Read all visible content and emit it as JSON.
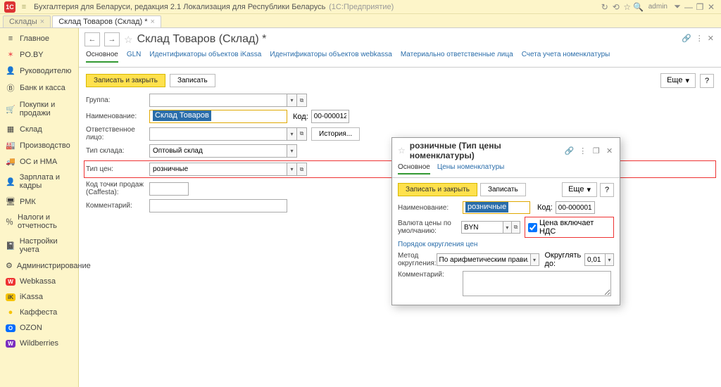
{
  "titlebar": {
    "logo": "1C",
    "menu_glyph": "≡",
    "title": "Бухгалтерия для Беларуси, редакция 2.1 Локализация для Республики Беларусь",
    "paren": "(1С:Предприятие)",
    "user": "admin",
    "icons": {
      "reload": "↻",
      "history": "⟲",
      "star": "☆",
      "search": "🔍",
      "sep": "⏷",
      "minimize": "—",
      "maximize": "❐",
      "close": "✕"
    }
  },
  "tabs": {
    "items": [
      {
        "label": "Склады"
      },
      {
        "label": "Склад Товаров (Склад) *"
      }
    ],
    "close": "×"
  },
  "sidebar": {
    "items": [
      {
        "icon": "≡",
        "label": "Главное"
      },
      {
        "icon": "✶",
        "label": "PO.BY",
        "iconColor": "#e55"
      },
      {
        "icon": "👤",
        "label": "Руководителю"
      },
      {
        "icon": "Ⓑ",
        "label": "Банк и касса"
      },
      {
        "icon": "🛒",
        "label": "Покупки и продажи"
      },
      {
        "icon": "▦",
        "label": "Склад"
      },
      {
        "icon": "🏭",
        "label": "Производство"
      },
      {
        "icon": "🚚",
        "label": "ОС и НМА"
      },
      {
        "icon": "👤",
        "label": "Зарплата и кадры"
      },
      {
        "icon": "🖥",
        "label": "РМК"
      },
      {
        "icon": "％",
        "label": "Налоги и отчетность"
      },
      {
        "icon": "📓",
        "label": "Настройки учета"
      },
      {
        "icon": "⚙",
        "label": "Администрирование"
      },
      {
        "icon": "W",
        "label": "Webkassa",
        "bg": "#e33",
        "fg": "#fff"
      },
      {
        "icon": "iK",
        "label": "iKassa",
        "bg": "#f6c300",
        "fg": "#444"
      },
      {
        "icon": "●",
        "label": "Каффеста",
        "iconColor": "#f6c300"
      },
      {
        "icon": "O",
        "label": "OZON",
        "bg": "#006cff",
        "fg": "#fff"
      },
      {
        "icon": "W",
        "label": "Wildberries",
        "bg": "#7b2fbf",
        "fg": "#fff"
      }
    ]
  },
  "form": {
    "nav": {
      "back": "←",
      "forward": "→",
      "star": "☆"
    },
    "title": "Склад Товаров (Склад) *",
    "header_icons": {
      "link": "🔗",
      "more": "⋮",
      "close": "✕"
    },
    "tabs": [
      {
        "label": "Основное",
        "current": true
      },
      {
        "label": "GLN"
      },
      {
        "label": "Идентификаторы объектов iKassa"
      },
      {
        "label": "Идентификаторы объектов webkassa"
      },
      {
        "label": "Материально ответственные лица"
      },
      {
        "label": "Счета учета номенклатуры"
      }
    ],
    "buttons": {
      "save_close": "Записать и закрыть",
      "save": "Записать",
      "more": "Еще",
      "help": "?"
    },
    "fields": {
      "group_label": "Группа:",
      "name_label": "Наименование:",
      "name_value": "Склад Товаров",
      "code_label": "Код:",
      "code_value": "00-000012",
      "responsible_label": "Ответственное лицо:",
      "history_btn": "История...",
      "type_label": "Тип склада:",
      "type_value": "Оптовый склад",
      "pricetype_label": "Тип цен:",
      "pricetype_value": "розничные",
      "pos_label": "Код точки продаж (Caffesta):",
      "comment_label": "Комментарий:"
    }
  },
  "popup": {
    "star": "☆",
    "title": "розничные (Тип цены номенклатуры)",
    "icons": {
      "link": "🔗",
      "more": "⋮",
      "window": "❐",
      "close": "✕"
    },
    "tabs": [
      {
        "label": "Основное",
        "current": true
      },
      {
        "label": "Цены номенклатуры"
      }
    ],
    "buttons": {
      "save_close": "Записать и закрыть",
      "save": "Записать",
      "more": "Еще",
      "help": "?"
    },
    "fields": {
      "name_label": "Наименование:",
      "name_value": "розничные",
      "code_label": "Код:",
      "code_value": "00-000001",
      "currency_label": "Валюта цены по умолчанию:",
      "currency_value": "BYN",
      "vat_label": "Цена включает НДС",
      "section": "Порядок округления цен",
      "round_method_label": "Метод округления:",
      "round_method_value": "По арифметическим правилам",
      "round_to_label": "Округлять до:",
      "round_to_value": "0,01",
      "comment_label": "Комментарий:"
    }
  }
}
